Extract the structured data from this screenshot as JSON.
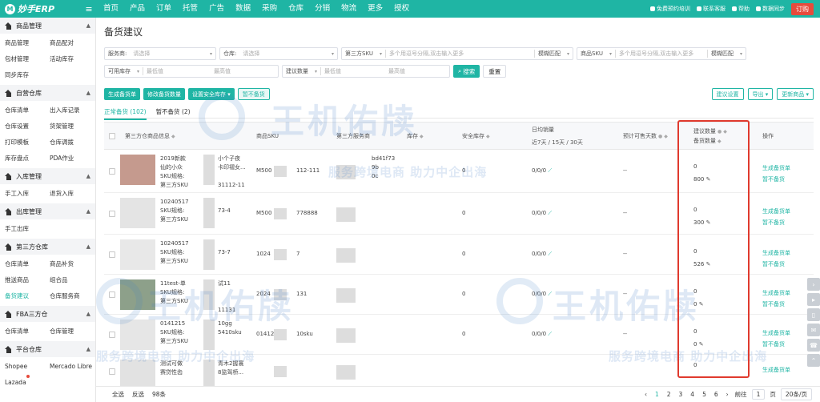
{
  "app": {
    "logo": "妙手ERP"
  },
  "nav": [
    "首页",
    "产品",
    "订单",
    "托管",
    "广告",
    "数据",
    "采购",
    "仓库",
    "分销",
    "物流",
    "更多",
    "授权"
  ],
  "top_right": {
    "items": [
      "免费预约培训",
      "联系客服",
      "帮助",
      "数据同步"
    ],
    "order": "订购"
  },
  "sidebar": [
    {
      "title": "商品管理",
      "items": [
        "商品管理",
        "商品配对",
        "包材管理",
        "活动库存",
        "同步库存"
      ]
    },
    {
      "title": "自营仓库",
      "items": [
        "仓库清单",
        "出入库记录",
        "仓库设置",
        "货架管理",
        "打印模板",
        "仓库调拨",
        "库存盘点",
        "PDA作业"
      ]
    },
    {
      "title": "入库管理",
      "items": [
        "手工入库",
        "退货入库"
      ]
    },
    {
      "title": "出库管理",
      "items": [
        "手工出库"
      ]
    },
    {
      "title": "第三方仓库",
      "items": [
        "仓库清单",
        "商品补货",
        "推送商品",
        "组合品",
        "备货建议",
        "仓库服务商"
      ]
    },
    {
      "title": "FBA三方仓",
      "items": [
        "仓库清单",
        "仓库管理"
      ]
    },
    {
      "title": "平台仓库",
      "items": [
        "Shopee",
        "Mercado Libre",
        "Lazada"
      ]
    }
  ],
  "page": {
    "title": "备货建议"
  },
  "filters": {
    "service": {
      "label": "服务商:",
      "placeholder": "请选择"
    },
    "warehouse": {
      "label": "仓库:",
      "placeholder": "请选择"
    },
    "third_sku": {
      "label": "第三方SKU",
      "placeholder": "多个用逗号分隔,双击输入更多",
      "mode": "模糊匹配"
    },
    "goods_sku": {
      "label": "商品SKU",
      "placeholder": "多个用逗号分隔,双击输入更多",
      "mode": "模糊匹配"
    },
    "stock": {
      "label": "可用库存",
      "min": "最低值",
      "max": "最高值"
    },
    "suggest": {
      "label": "建议数量",
      "min": "最低值",
      "max": "最高值"
    },
    "search": "搜索",
    "reset": "重置"
  },
  "actions": {
    "generate": "生成备货单",
    "modify_qty": "修改备货数量",
    "safety_stock": "设置安全库存",
    "no_stock": "暂不备货",
    "suggest_settings": "建议设置",
    "export": "导出",
    "update": "更新商品"
  },
  "tabs": [
    {
      "label": "正常备货 (102)",
      "active": true
    },
    {
      "label": "暂不备货 (2)",
      "active": false
    }
  ],
  "table": {
    "headers": {
      "third_name": "第三方仓商品信息",
      "goods_sku": "商品SKU",
      "provider": "第三方服务商",
      "stock": "库存",
      "safety": "安全库存",
      "daily_sales": "日均销量",
      "daily_sub": "近7天 / 15天 / 30天",
      "days": "预计可售天数",
      "suggest": "建议数量",
      "stock_qty": "备货数量",
      "ops": "操作"
    },
    "rows": [
      {
        "name": "2019新款",
        "line2": "仙的小众",
        "line3": "SKU规格:",
        "line4": "第三方SKU",
        "extra1": "小个子夜",
        "extra2": "卡印褶女...",
        "extra3": "31112-11",
        "sku": "M500",
        "sku2": "112-111",
        "prov1": "bd41f73",
        "prov2": "9b",
        "prov3": "0c",
        "stock": "",
        "safety": "0",
        "sales": "0/0/0",
        "days": "--",
        "suggest": "0",
        "qty": "800",
        "op1": "生成备货单",
        "op2": "暂不备货"
      },
      {
        "name": "10240517",
        "line2": "SKU规格:",
        "line3": "第三方SKU",
        "line4": "",
        "extra1": "",
        "extra2": "73-4",
        "extra3": "",
        "sku": "M500",
        "sku2": "778888",
        "prov1": "",
        "prov2": "",
        "prov3": "",
        "stock": "",
        "safety": "0",
        "sales": "0/0/0",
        "days": "--",
        "suggest": "0",
        "qty": "300",
        "op1": "生成备货单",
        "op2": "暂不备货"
      },
      {
        "name": "10240517",
        "line2": "SKU规格:",
        "line3": "第三方SKU",
        "line4": "",
        "extra1": "",
        "extra2": "73-7",
        "extra3": "",
        "sku": "1024",
        "sku2": "7",
        "prov1": "",
        "prov2": "",
        "prov3": "",
        "stock": "",
        "safety": "0",
        "sales": "0/0/0",
        "days": "--",
        "suggest": "0",
        "qty": "526",
        "op1": "生成备货单",
        "op2": "暂不备货"
      },
      {
        "name": "11test-单",
        "line2": "SKU规格:",
        "line3": "第三方SKU",
        "line4": "",
        "extra1": "试11",
        "extra2": "",
        "extra3": "11131",
        "sku": "2024",
        "sku2": "131",
        "prov1": "",
        "prov2": "",
        "prov3": "",
        "stock": "",
        "safety": "0",
        "sales": "0/0/0",
        "days": "--",
        "suggest": "0",
        "qty": "0",
        "op1": "生成备货单",
        "op2": "暂不备货"
      },
      {
        "name": "0141215",
        "line2": "SKU规格:",
        "line3": "第三方SKU",
        "line4": "",
        "extra1": "10gg",
        "extra2": "5410sku",
        "extra3": "",
        "sku": "01412",
        "sku2": "10sku",
        "prov1": "",
        "prov2": "",
        "prov3": "",
        "stock": "",
        "safety": "0",
        "sales": "0/0/0",
        "days": "--",
        "suggest": "0",
        "qty": "0",
        "op1": "生成备货单",
        "op2": "暂不备货"
      },
      {
        "name": "测试可做",
        "line2": "赛贷性齿",
        "line3": "",
        "line4": "",
        "extra1": "青木2握寰",
        "extra2": "8监驾桥...",
        "extra3": "",
        "sku": "",
        "sku2": "",
        "prov1": "",
        "prov2": "",
        "prov3": "",
        "stock": "",
        "safety": "",
        "sales": "",
        "days": "",
        "suggest": "0",
        "qty": "",
        "op1": "生成备货单",
        "op2": ""
      }
    ]
  },
  "footer": {
    "select_all": "全选",
    "invert": "反选",
    "count": "98条",
    "pages": [
      "1",
      "2",
      "3",
      "4",
      "5",
      "6"
    ],
    "goto_label": "前往",
    "goto_value": "1",
    "page_unit": "页",
    "page_size": "20条/页"
  },
  "watermark": {
    "brand": "王机佑牍",
    "slogan": "服务跨境电商 助力中企出海"
  },
  "colors": {
    "primary": "#1fb5a4",
    "highlight": "#e03a2e",
    "order": "#e64b3c"
  }
}
